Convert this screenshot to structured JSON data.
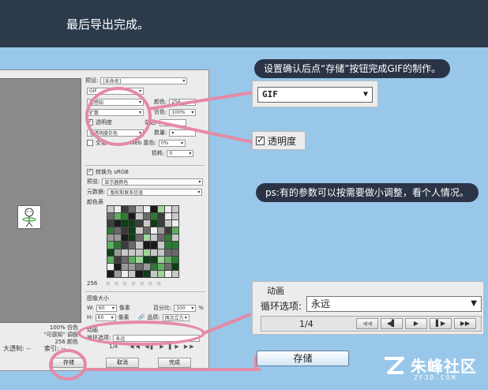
{
  "header": {
    "title": "最后导出完成。"
  },
  "callouts": {
    "save_hint": "设置确认后点“存储”按钮完成GIF的制作。",
    "params_hint": "ps:有的参数可以按需要做小调整，看个人情况。"
  },
  "dialog": {
    "panel": {
      "preset_label": "预设:",
      "preset_value": "[未命名]",
      "format_value": "GIF",
      "reduction_value": "可感知",
      "dither_value": "扩散",
      "colors_label": "颜色:",
      "colors_value": "256",
      "dither_label": "仿色:",
      "dither_pct": "100%",
      "transparency_label": "透明度",
      "matte_label": "杂边:",
      "no_trans_dither": "无透明度仿色",
      "amount_label": "数量:",
      "interlaced_label": "交错",
      "web_snap_label": "Web 靠色:",
      "web_snap_value": "0%",
      "lossy_label": "损耗:",
      "lossy_value": "0",
      "srgb_label": "转换为 sRGB",
      "preview_label": "预览:",
      "preview_value": "显示器颜色",
      "metadata_label": "元数据:",
      "metadata_value": "版权和联系信息",
      "color_table_label": "颜色表",
      "color_count": "256",
      "image_size_label": "图像大小",
      "w_label": "W:",
      "w_value": "60",
      "h_label": "H:",
      "h_value": "60",
      "unit": "像素",
      "percent_label": "百分比:",
      "percent_value": "100",
      "percent_unit": "%",
      "quality_label": "品质:",
      "quality_value": "两次立方",
      "animation_label": "动画",
      "loop_label": "循环选项:",
      "loop_value": "永远",
      "frame_count": "1/4"
    },
    "preview_info": [
      "100% 仿色",
      "\"可感知\" 调板",
      "256 颜色"
    ],
    "bottom": {
      "size_label": "大透制:",
      "size_value": "--",
      "index_label": "索引:",
      "index_value": "--"
    },
    "buttons": {
      "save": "存储",
      "cancel": "取消",
      "done": "完成"
    }
  },
  "zoom": {
    "format_value": "GIF",
    "transparency_label": "透明度",
    "animation_label": "动画",
    "loop_label": "循环选项:",
    "loop_value": "永远",
    "frame_count": "1/4",
    "save_button": "存储"
  },
  "logo": {
    "cn": "朱峰社区",
    "url": "ZF3D.COM"
  },
  "colors": {
    "background": "#98c7ea",
    "header": "#2c3a4c",
    "callout": "#2a3446",
    "highlight": "#e58aa4"
  }
}
